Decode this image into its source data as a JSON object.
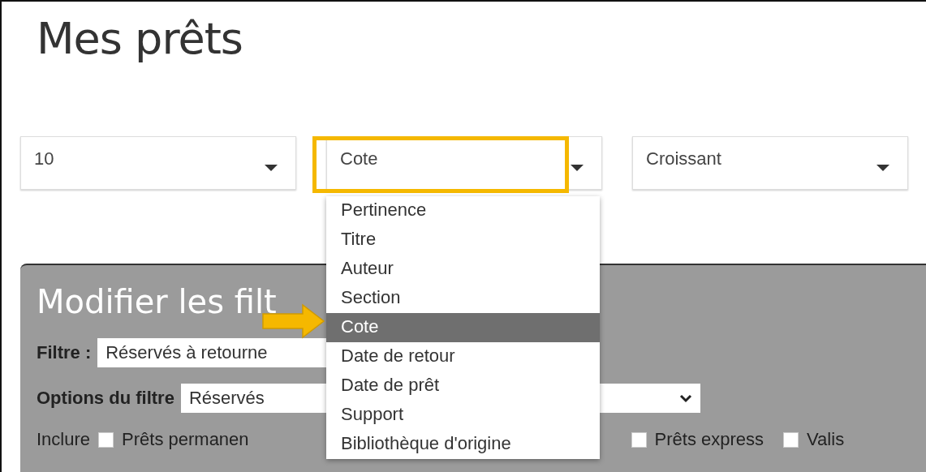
{
  "title": "Mes prêts",
  "sort_controls": [
    {
      "value": "10",
      "expanded": false
    },
    {
      "value": "Cote",
      "expanded": true
    },
    {
      "value": "Croissant",
      "expanded": false
    }
  ],
  "sort_menu": {
    "options": [
      {
        "label": "Pertinence",
        "selected": false
      },
      {
        "label": "Titre",
        "selected": false
      },
      {
        "label": "Auteur",
        "selected": false
      },
      {
        "label": "Section",
        "selected": false
      },
      {
        "label": "Cote",
        "selected": true
      },
      {
        "label": "Date de retour",
        "selected": false
      },
      {
        "label": "Date de prêt",
        "selected": false
      },
      {
        "label": "Support",
        "selected": false
      },
      {
        "label": "Bibliothèque d'origine",
        "selected": false
      }
    ]
  },
  "filters": {
    "title": "Modifier les filt",
    "filter_label": "Filtre :",
    "filter_value": "Réservés à retourne",
    "options_label": "Options du filtre",
    "options_value": "Réservés",
    "include_label": "Inclure",
    "include_options": [
      {
        "label": "Prêts permanen",
        "checked": false
      },
      {
        "label": "Prêts express",
        "checked": false
      },
      {
        "label": "Valis",
        "checked": false
      }
    ]
  }
}
